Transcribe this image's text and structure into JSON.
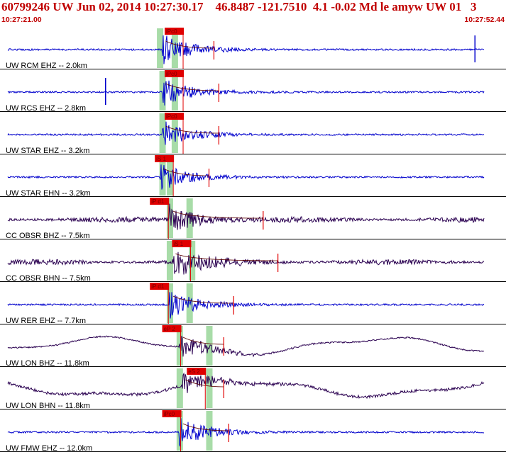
{
  "header": {
    "title": "60799246 UW Jun 02, 2014 10:27:30.17    46.8487 -121.7510  4.1 -0.02 Md le amyw UW 01   3",
    "start_time": "10:27:21.00",
    "end_time": "10:27:52.44"
  },
  "colors": {
    "header_text": "#c00000",
    "trace_blue": "#0000cc",
    "trace_purple": "#2a0050",
    "pick_line": "#e00000",
    "pick_tag_bg": "#e00000",
    "window_green": "#a8dca8",
    "separator": "#000000"
  },
  "traces": [
    {
      "label": "UW RCM EHZ -- 2.0km",
      "color": "blue",
      "picks": [
        {
          "tag": "iPc0",
          "t": 0.33
        }
      ],
      "windows": [
        0.32,
        0.35
      ],
      "onset": 0.325,
      "coda": 0.43,
      "amp": 22,
      "lp": false,
      "extra_spike": 0.96
    },
    {
      "label": "UW RCS EHZ -- 2.8km",
      "color": "blue",
      "picks": [
        {
          "tag": "iPc0",
          "t": 0.33
        }
      ],
      "windows": [
        0.325,
        0.35
      ],
      "onset": 0.325,
      "coda": 0.44,
      "amp": 20,
      "lp": false,
      "extra_spike": 0.21
    },
    {
      "label": "UW STAR EHZ -- 3.2km",
      "color": "blue",
      "picks": [
        {
          "tag": "iPc0",
          "t": 0.33
        }
      ],
      "windows": [
        0.325,
        0.35
      ],
      "onset": 0.325,
      "coda": 0.44,
      "amp": 20,
      "lp": false
    },
    {
      "label": "UW STAR EHN -- 3.2km",
      "color": "blue",
      "picks": [
        {
          "tag": "iS 1",
          "t": 0.31
        }
      ],
      "windows": [
        0.325,
        0.34
      ],
      "onset": 0.32,
      "coda": 0.42,
      "amp": 20,
      "lp": false
    },
    {
      "label": "CC OBSR BHZ -- 7.5km",
      "color": "purple",
      "picks": [
        {
          "tag": "iP d1",
          "t": 0.3
        }
      ],
      "windows": [
        0.34,
        0.38
      ],
      "onset": 0.34,
      "coda": 0.53,
      "amp": 20,
      "lp": false
    },
    {
      "label": "CC OBSR BHN -- 7.5km",
      "color": "purple",
      "picks": [
        {
          "tag": "iS 1",
          "t": 0.345
        }
      ],
      "windows": [
        0.34,
        0.385
      ],
      "onset": 0.345,
      "coda": 0.56,
      "amp": 22,
      "lp": false
    },
    {
      "label": "UW RER EHZ -- 7.7km",
      "color": "blue",
      "picks": [
        {
          "tag": "iP d1",
          "t": 0.3
        }
      ],
      "windows": [
        0.34,
        0.38
      ],
      "onset": 0.34,
      "coda": 0.47,
      "amp": 20,
      "lp": false
    },
    {
      "label": "UW LON BHZ -- 11.8km",
      "color": "purple",
      "picks": [
        {
          "tag": "eP 2",
          "t": 0.325
        }
      ],
      "windows": [
        0.36,
        0.42
      ],
      "onset": 0.36,
      "coda": 0.45,
      "amp": 18,
      "lp": true
    },
    {
      "label": "UW LON BHN -- 11.8km",
      "color": "purple",
      "picks": [
        {
          "tag": "eS 2",
          "t": 0.375
        }
      ],
      "windows": [
        0.36,
        0.42
      ],
      "onset": 0.365,
      "coda": 0.45,
      "amp": 16,
      "lp": true
    },
    {
      "label": "UW FMW EHZ -- 12.0km",
      "color": "blue",
      "picks": [
        {
          "tag": "iPc0",
          "t": 0.325
        }
      ],
      "windows": [
        0.36,
        0.42
      ],
      "onset": 0.36,
      "coda": 0.46,
      "amp": 20,
      "lp": false
    }
  ]
}
